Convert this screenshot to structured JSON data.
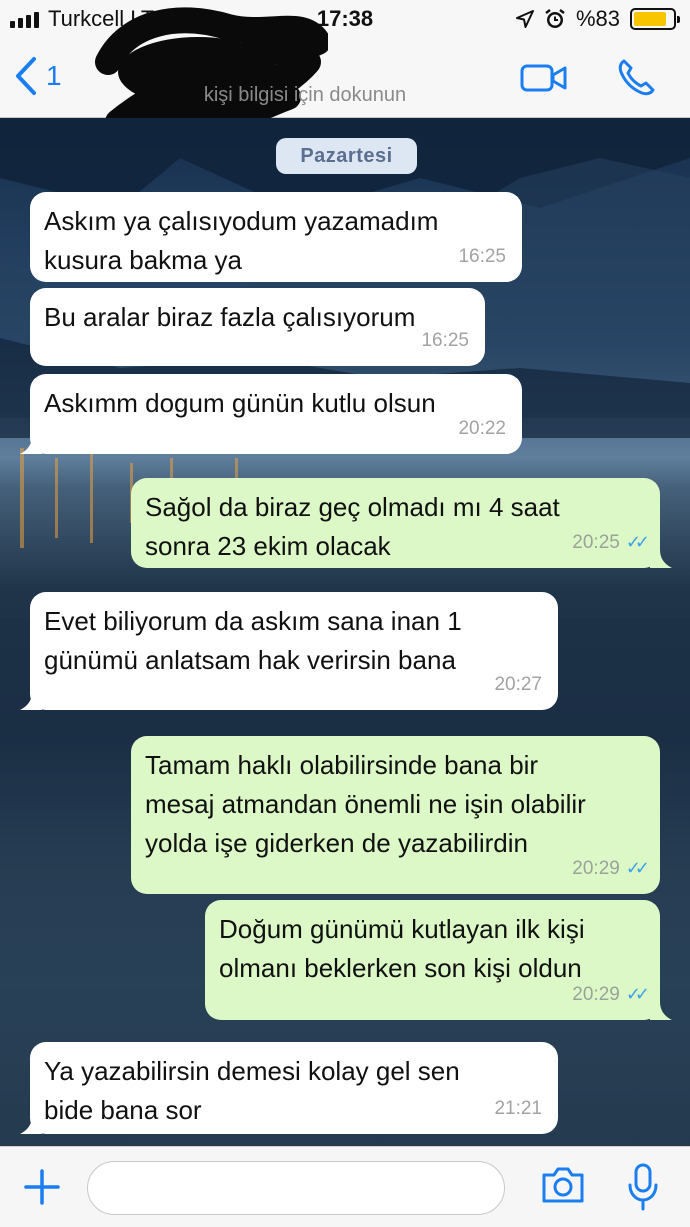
{
  "status_bar": {
    "carrier": "Turkcell  LTE",
    "time": "17:38",
    "battery_text": "%83",
    "battery_level": 0.83,
    "icons": [
      "signal-icon",
      "location-icon",
      "alarm-icon",
      "battery-icon"
    ]
  },
  "header": {
    "back_count": "1",
    "subtitle": "kişi bilgisi için dokunun",
    "icons": [
      "chevron-left-icon",
      "video-call-icon",
      "phone-icon"
    ]
  },
  "chat": {
    "day_label": "Pazartesi",
    "messages": [
      {
        "direction": "in",
        "text": "Askım ya çalısıyodum yazamadım\nkusura bakma ya",
        "time": "16:25"
      },
      {
        "direction": "in",
        "text": "Bu aralar biraz fazla çalısıyorum",
        "time": "16:25"
      },
      {
        "direction": "in",
        "text": "Askımm dogum günün kutlu olsun",
        "time": "20:22"
      },
      {
        "direction": "out",
        "text": "Sağol da biraz geç olmadı mı 4 saat\nsonra 23 ekim olacak",
        "time": "20:25",
        "read": true
      },
      {
        "direction": "in",
        "text": "Evet biliyorum da askım sana inan 1\ngünümü anlatsam hak verirsin bana",
        "time": "20:27"
      },
      {
        "direction": "out",
        "text": "Tamam haklı olabilirsinde bana bir\nmesaj atmandan önemli ne işin olabilir\nyolda işe giderken de yazabilirdin",
        "time": "20:29",
        "read": true
      },
      {
        "direction": "out",
        "text": "Doğum günümü kutlayan ilk kişi\nolmanı beklerken son kişi oldun",
        "time": "20:29",
        "read": true
      },
      {
        "direction": "in",
        "text": "Ya yazabilirsin demesi kolay gel sen\nbide bana sor",
        "time": "21:21"
      }
    ]
  },
  "input_bar": {
    "placeholder": "",
    "icons": [
      "plus-icon",
      "camera-icon",
      "microphone-icon"
    ]
  },
  "colors": {
    "accent": "#1a7ef0",
    "incoming_bubble": "#ffffff",
    "outgoing_bubble": "#dcf8c6",
    "read_ticks": "#3ca3e8",
    "battery": "#f7c600"
  }
}
